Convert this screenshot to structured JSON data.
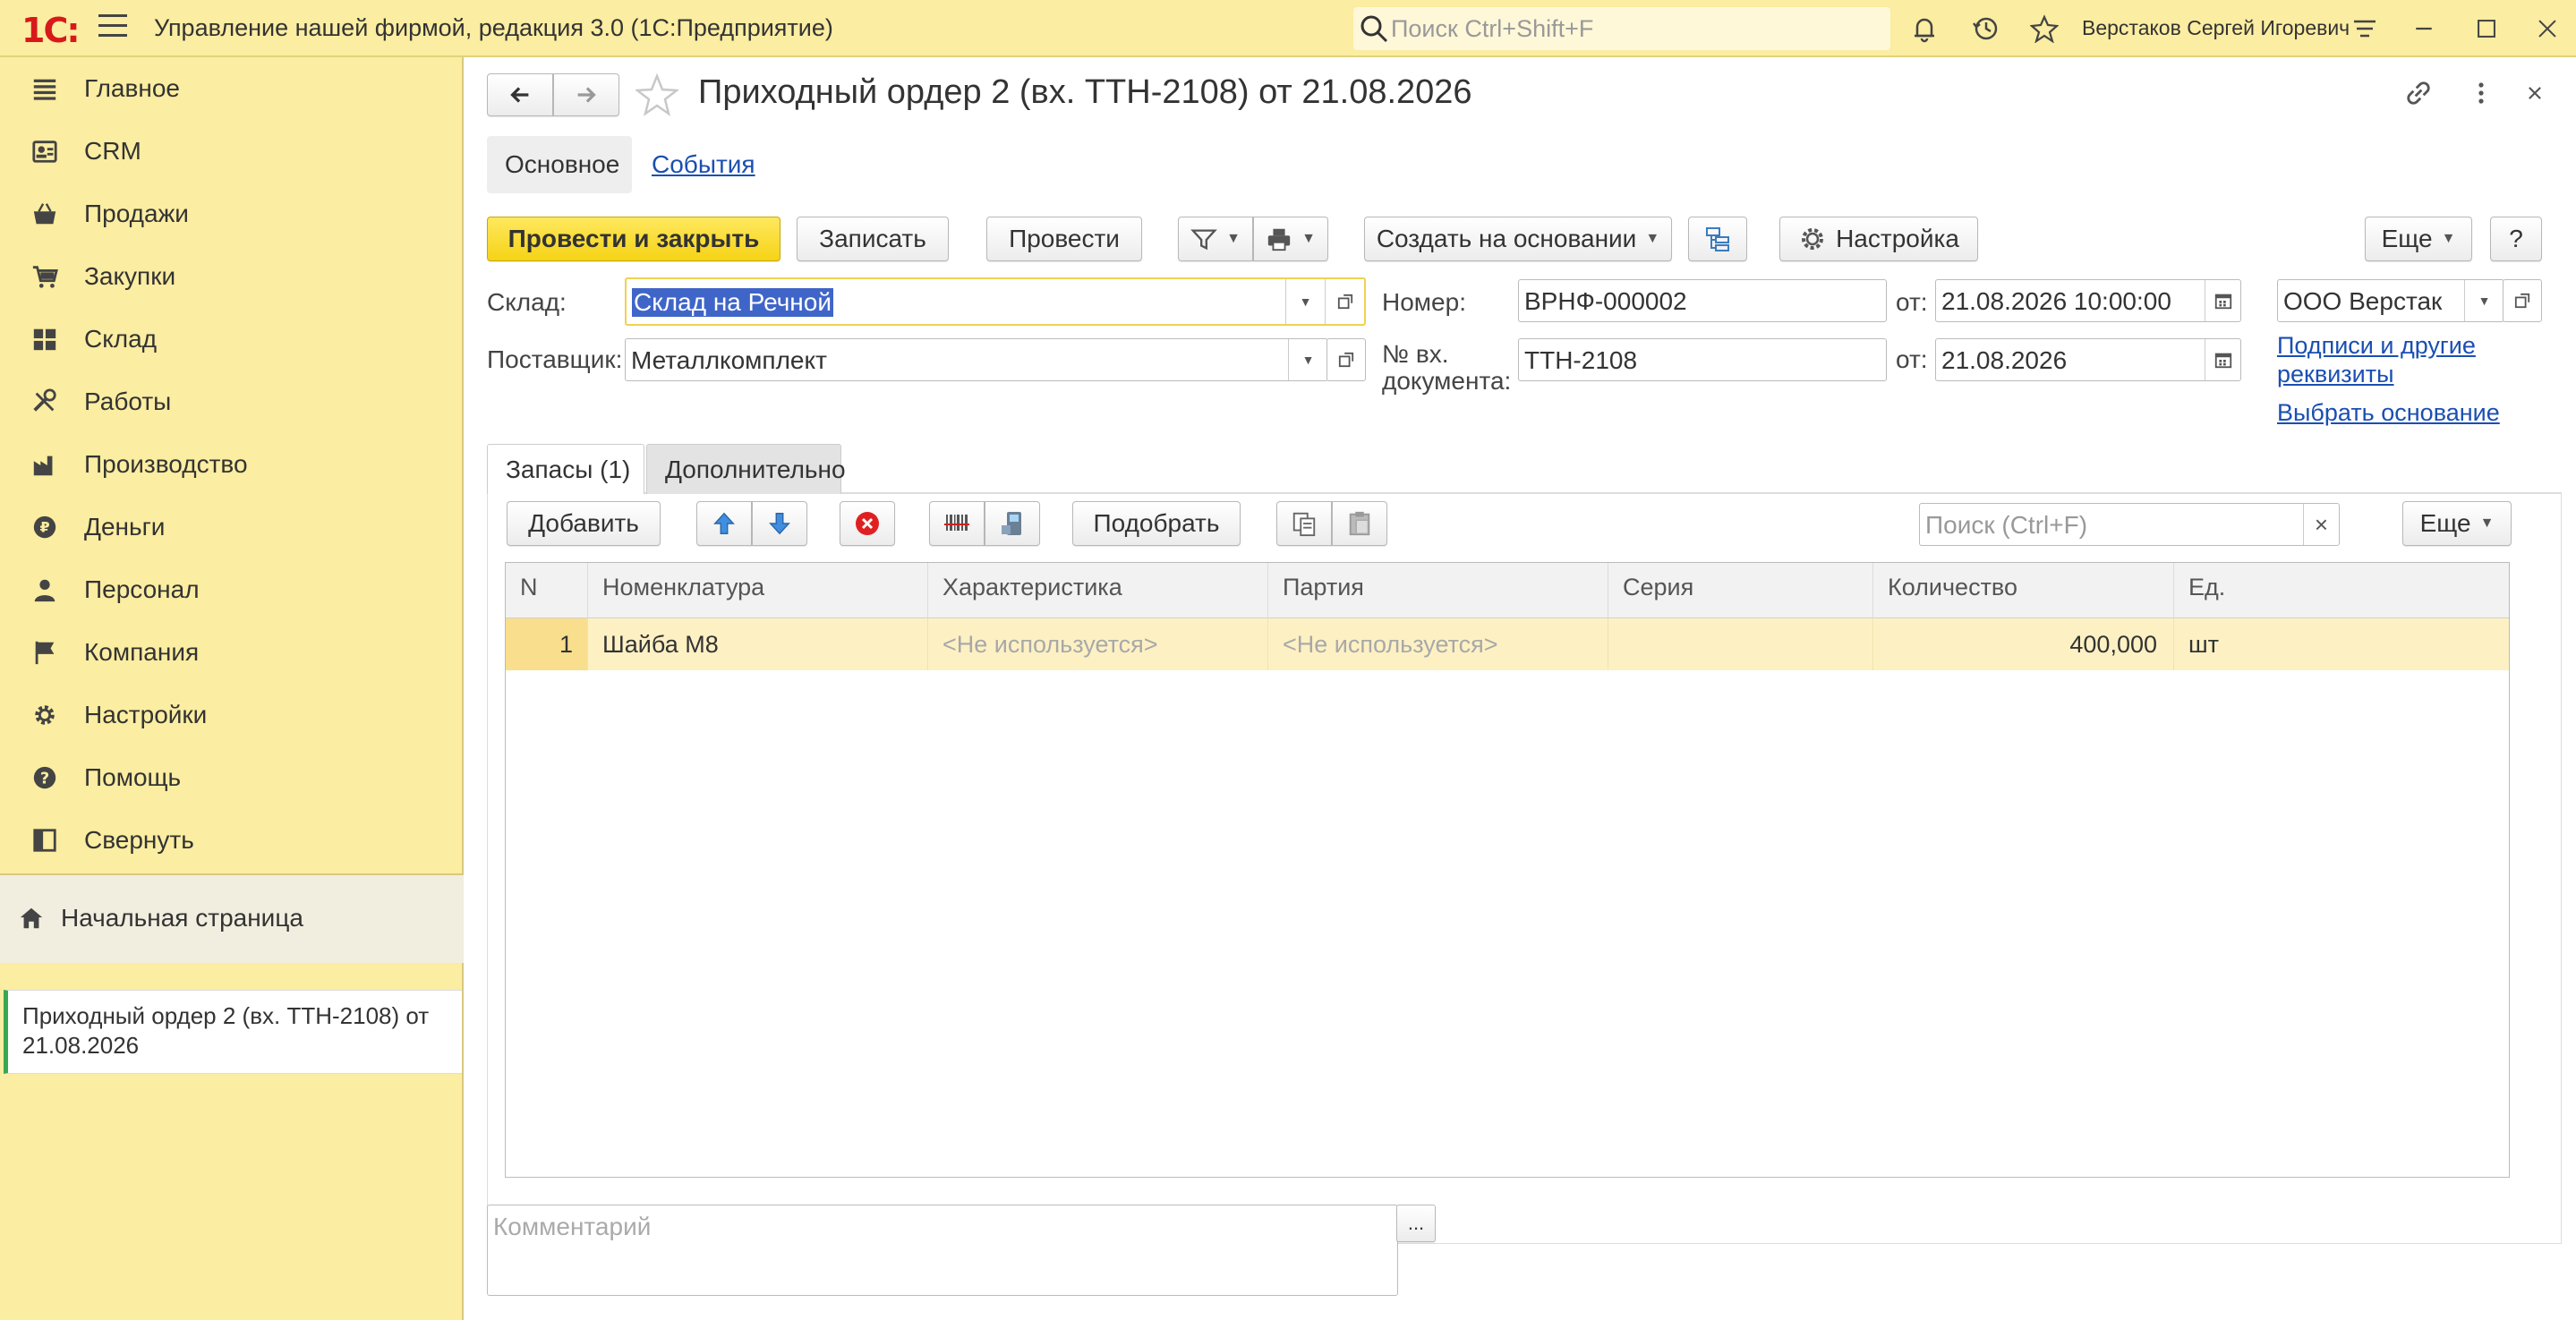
{
  "app": {
    "logo": "1С:",
    "title": "Управление нашей фирмой, редакция 3.0  (1С:Предприятие)",
    "search_placeholder": "Поиск Ctrl+Shift+F",
    "user": "Верстаков Сергей Игоревич"
  },
  "sidebar": {
    "items": [
      {
        "label": "Главное",
        "icon": "list-icon"
      },
      {
        "label": "CRM",
        "icon": "contacts-icon"
      },
      {
        "label": "Продажи",
        "icon": "basket-icon"
      },
      {
        "label": "Закупки",
        "icon": "cart-icon"
      },
      {
        "label": "Склад",
        "icon": "warehouse-icon"
      },
      {
        "label": "Работы",
        "icon": "tools-icon"
      },
      {
        "label": "Производство",
        "icon": "factory-icon"
      },
      {
        "label": "Деньги",
        "icon": "ruble-icon"
      },
      {
        "label": "Персонал",
        "icon": "person-icon"
      },
      {
        "label": "Компания",
        "icon": "flag-icon"
      },
      {
        "label": "Настройки",
        "icon": "gear-icon"
      },
      {
        "label": "Помощь",
        "icon": "help-icon"
      },
      {
        "label": "Свернуть",
        "icon": "collapse-icon"
      }
    ],
    "home": "Начальная страница",
    "open_doc": "Приходный ордер 2 (вх. ТТН-2108) от 21.08.2026"
  },
  "document": {
    "title": "Приходный ордер 2 (вх. ТТН-2108) от 21.08.2026",
    "tabs": {
      "main": "Основное",
      "events": "События"
    },
    "toolbar": {
      "post_close": "Провести и закрыть",
      "save": "Записать",
      "post": "Провести",
      "create_based": "Создать на основании",
      "settings": "Настройка",
      "more": "Еще",
      "help": "?"
    },
    "fields": {
      "warehouse_label": "Склад:",
      "warehouse": "Склад на Речной",
      "supplier_label": "Поставщик:",
      "supplier": "Металлкомплект",
      "number_label": "Номер:",
      "number": "ВРНФ-000002",
      "from_label": "от:",
      "date": "21.08.2026 10:00:00",
      "incoming_doc_label_1": "№ вх.",
      "incoming_doc_label_2": "документа:",
      "incoming_doc": "ТТН-2108",
      "incoming_date": "21.08.2026",
      "company": "ООО Верстак",
      "signatures_link": "Подписи и другие реквизиты",
      "choose_basis_link": "Выбрать основание"
    },
    "inner_tabs": {
      "stock": "Запасы (1)",
      "extra": "Дополнительно"
    },
    "table_toolbar": {
      "add": "Добавить",
      "pick": "Подобрать",
      "search_placeholder": "Поиск (Ctrl+F)",
      "more": "Еще"
    },
    "table": {
      "columns": [
        "N",
        "Номенклатура",
        "Характеристика",
        "Партия",
        "Серия",
        "Количество",
        "Ед."
      ],
      "rows": [
        {
          "n": "1",
          "item": "Шайба М8",
          "characteristic": "<Не используется>",
          "batch": "<Не используется>",
          "series": "",
          "qty": "400,000",
          "unit": "шт"
        }
      ]
    },
    "comment_placeholder": "Комментарий",
    "comment_more": "..."
  }
}
